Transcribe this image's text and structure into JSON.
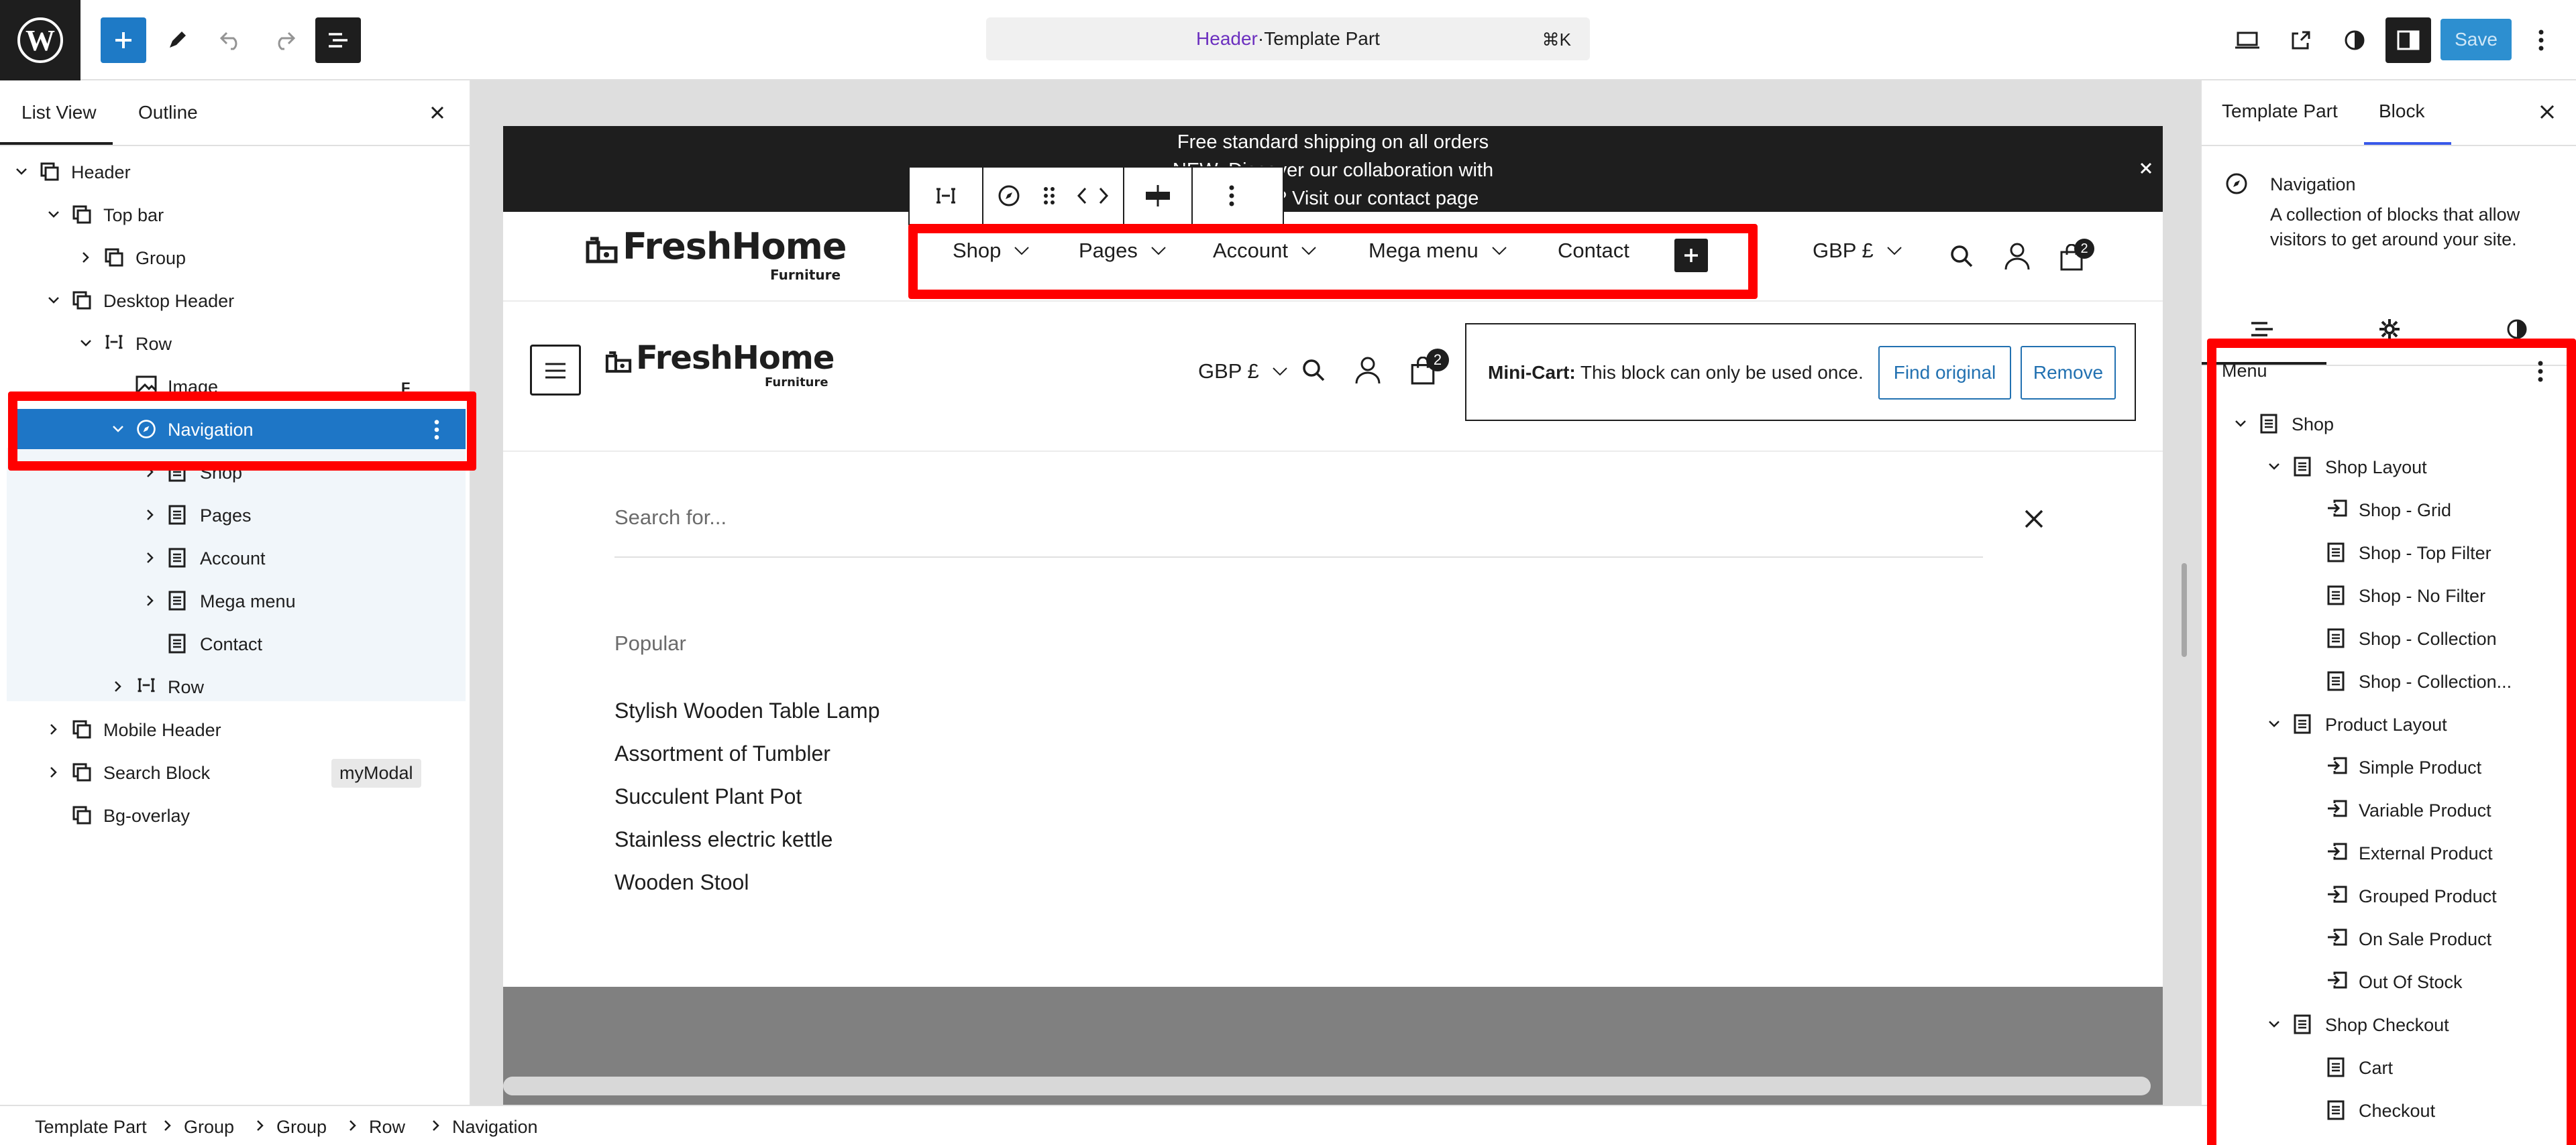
{
  "topbar": {
    "command": {
      "part": "Header",
      "separator": " · ",
      "type": "Template Part",
      "shortcut": "⌘K"
    },
    "save_label": "Save"
  },
  "left_panel": {
    "tabs": [
      "List View",
      "Outline"
    ],
    "tree": [
      {
        "label": "Header",
        "icon": "template-part-icon"
      },
      {
        "label": "Top bar",
        "icon": "template-part-icon"
      },
      {
        "label": "Group",
        "icon": "template-part-icon"
      },
      {
        "label": "Desktop Header",
        "icon": "template-part-icon"
      },
      {
        "label": "Row",
        "icon": "row-icon"
      },
      {
        "label": "Image",
        "icon": "image-icon",
        "badge": "F"
      },
      {
        "label": "Navigation",
        "icon": "navigation-icon",
        "selected": true
      },
      {
        "label": "Shop",
        "icon": "page-icon"
      },
      {
        "label": "Pages",
        "icon": "page-icon"
      },
      {
        "label": "Account",
        "icon": "page-icon"
      },
      {
        "label": "Mega menu",
        "icon": "page-icon"
      },
      {
        "label": "Contact",
        "icon": "page-icon"
      },
      {
        "label": "Row",
        "icon": "row-icon"
      },
      {
        "label": "Mobile Header",
        "icon": "template-part-icon"
      },
      {
        "label": "Search Block",
        "icon": "template-part-icon",
        "badge": "myModal"
      },
      {
        "label": "Bg-overlay",
        "icon": "template-part-icon"
      }
    ]
  },
  "canvas": {
    "announcement": [
      "Free standard shipping on all orders",
      "NEW: Discover our collaboration with",
      "Need help? Visit our contact page"
    ],
    "logo": {
      "name": "FreshHome",
      "sub": "Furniture"
    },
    "nav": [
      "Shop",
      "Pages",
      "Account",
      "Mega menu",
      "Contact"
    ],
    "currency": "GBP £",
    "cart_count": "2",
    "minicart": {
      "bold": "Mini-Cart:",
      "text": " This block can only be used once.",
      "find": "Find original",
      "remove": "Remove"
    },
    "search_placeholder": "Search for...",
    "popular_heading": "Popular",
    "popular_items": [
      "Stylish Wooden Table Lamp",
      "Assortment of Tumbler",
      "Succulent Plant Pot",
      "Stainless electric kettle",
      "Wooden Stool"
    ]
  },
  "right_panel": {
    "tabs": [
      "Template Part",
      "Block"
    ],
    "block": {
      "title": "Navigation",
      "description": "A collection of blocks that allow visitors to get around your site."
    },
    "menu_heading": "Menu",
    "menu": [
      {
        "label": "Shop",
        "depth": 0,
        "icon": "page-icon",
        "expand": true
      },
      {
        "label": "Shop Layout",
        "depth": 1,
        "icon": "page-icon",
        "expand": true
      },
      {
        "label": "Shop - Grid",
        "depth": 2,
        "icon": "link-icon"
      },
      {
        "label": "Shop - Top Filter",
        "depth": 2,
        "icon": "page-icon"
      },
      {
        "label": "Shop - No Filter",
        "depth": 2,
        "icon": "page-icon"
      },
      {
        "label": "Shop - Collection",
        "depth": 2,
        "icon": "page-icon"
      },
      {
        "label": "Shop - Collection...",
        "depth": 2,
        "icon": "page-icon"
      },
      {
        "label": "Product Layout",
        "depth": 1,
        "icon": "page-icon",
        "expand": true
      },
      {
        "label": "Simple Product",
        "depth": 2,
        "icon": "link-icon"
      },
      {
        "label": "Variable Product",
        "depth": 2,
        "icon": "link-icon"
      },
      {
        "label": "External Product",
        "depth": 2,
        "icon": "link-icon"
      },
      {
        "label": "Grouped Product",
        "depth": 2,
        "icon": "link-icon"
      },
      {
        "label": "On Sale Product",
        "depth": 2,
        "icon": "link-icon"
      },
      {
        "label": "Out Of Stock",
        "depth": 2,
        "icon": "link-icon"
      },
      {
        "label": "Shop Checkout",
        "depth": 1,
        "icon": "page-icon",
        "expand": true
      },
      {
        "label": "Cart",
        "depth": 2,
        "icon": "page-icon"
      },
      {
        "label": "Checkout",
        "depth": 2,
        "icon": "page-icon"
      }
    ]
  },
  "breadcrumb": [
    "Template Part",
    "Group",
    "Group",
    "Row",
    "Navigation"
  ]
}
